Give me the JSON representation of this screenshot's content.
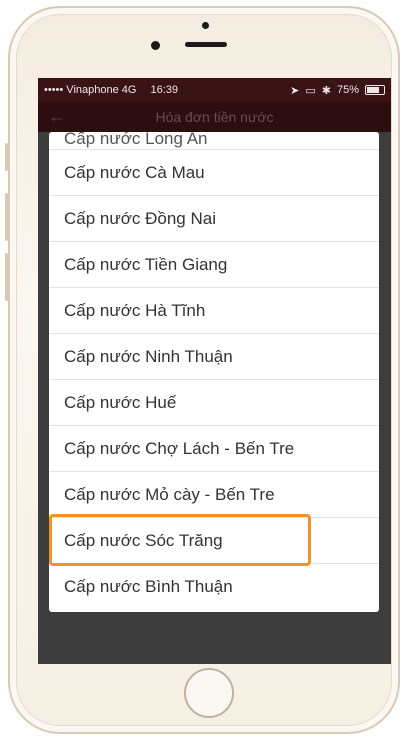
{
  "status_bar": {
    "carrier": "••••• Vinaphone  4G",
    "time": "16:39",
    "battery": "75%",
    "battery_level": 0.75
  },
  "nav": {
    "title": "Hóa đơn tiền nước",
    "back_icon": "arrow-left-icon"
  },
  "list": {
    "partial_label": "Cấp nước Long An",
    "items": [
      "Cấp nước Cà Mau",
      "Cấp nước Đồng Nai",
      "Cấp nước Tiền Giang",
      "Cấp nước Hà Tĩnh",
      "Cấp nước Ninh Thuận",
      "Cấp nước Huế",
      "Cấp nước Chợ Lách - Bến Tre",
      "Cấp nước Mỏ cày - Bến Tre",
      "Cấp nước Sóc Trăng",
      "Cấp nước Bình Thuận"
    ],
    "highlighted": "Cấp nước Sóc Trăng"
  },
  "colors": {
    "status_bg": "#3a1316",
    "nav_bg": "#2c0d10",
    "highlight": "#f0932a",
    "overlay": "#3d3d3d"
  }
}
